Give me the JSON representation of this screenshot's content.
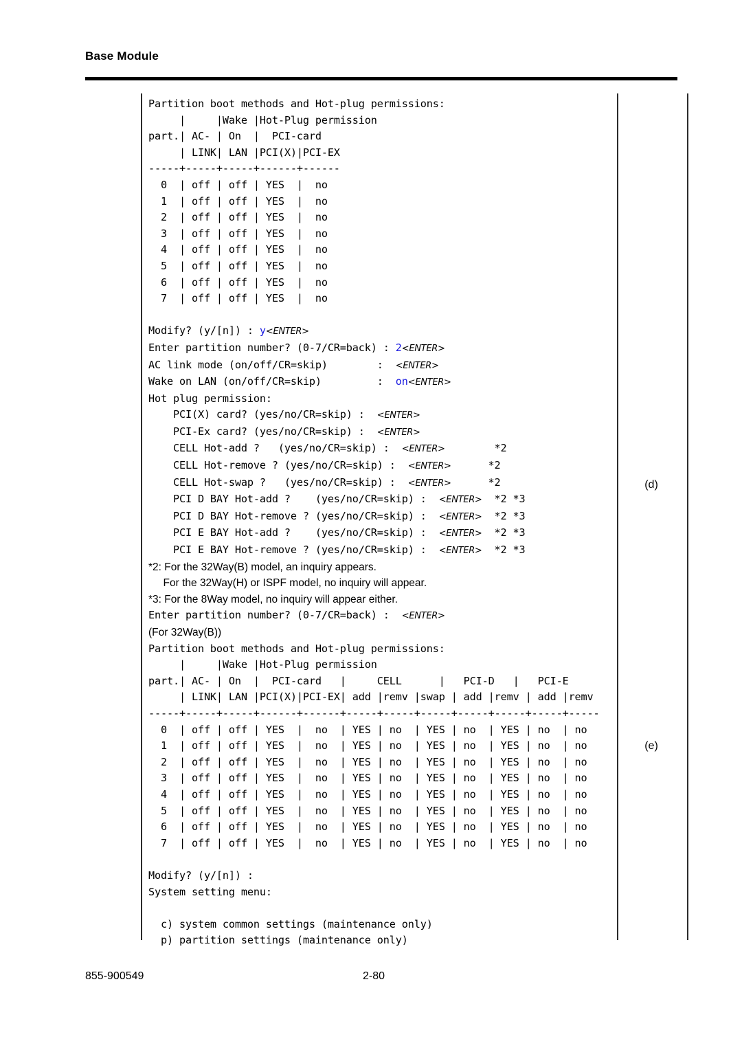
{
  "header": {
    "title": "Base Module"
  },
  "footer": {
    "doc_number": "855-900549",
    "page_number": "2-80"
  },
  "callouts": {
    "d": "(d)",
    "e": "(e)"
  },
  "terminal": {
    "lines": [
      {
        "text": "Partition boot methods and Hot-plug permissions:"
      },
      {
        "text": "     |     |Wake |Hot-Plug permission"
      },
      {
        "text": "part.| AC- | On  |  PCI-card"
      },
      {
        "text": "     | LINK| LAN |PCI(X)|PCI-EX"
      },
      {
        "text": "-----+-----+-----+------+------"
      },
      {
        "text": "  0  | off | off | YES  |  no"
      },
      {
        "text": "  1  | off | off | YES  |  no"
      },
      {
        "text": "  2  | off | off | YES  |  no"
      },
      {
        "text": "  3  | off | off | YES  |  no"
      },
      {
        "text": "  4  | off | off | YES  |  no"
      },
      {
        "text": "  5  | off | off | YES  |  no"
      },
      {
        "text": "  6  | off | off | YES  |  no"
      },
      {
        "text": "  7  | off | off | YES  |  no"
      },
      {
        "text": ""
      },
      {
        "segments": [
          {
            "text": "Modify? (y/[n]) : ",
            "style": "plain"
          },
          {
            "text": "y",
            "style": "input"
          },
          {
            "text": "<ENTER>",
            "style": "key"
          }
        ]
      },
      {
        "segments": [
          {
            "text": "Enter partition number? (0-7/CR=back) : ",
            "style": "plain"
          },
          {
            "text": "2",
            "style": "input"
          },
          {
            "text": "<ENTER>",
            "style": "key"
          }
        ]
      },
      {
        "segments": [
          {
            "text": "AC link mode (on/off/CR=skip)        :  ",
            "style": "plain"
          },
          {
            "text": "<ENTER>",
            "style": "key"
          }
        ]
      },
      {
        "segments": [
          {
            "text": "Wake on LAN (on/off/CR=skip)         :  ",
            "style": "plain"
          },
          {
            "text": "on",
            "style": "input"
          },
          {
            "text": "<ENTER>",
            "style": "key"
          }
        ]
      },
      {
        "text": "Hot plug permission:"
      },
      {
        "segments": [
          {
            "text": "    PCI(X) card? (yes/no/CR=skip) :  ",
            "style": "plain"
          },
          {
            "text": "<ENTER>",
            "style": "key"
          }
        ]
      },
      {
        "segments": [
          {
            "text": "    PCI-Ex card? (yes/no/CR=skip) :  ",
            "style": "plain"
          },
          {
            "text": "<ENTER>",
            "style": "key"
          }
        ]
      },
      {
        "segments": [
          {
            "text": "    CELL Hot-add ?   (yes/no/CR=skip) :  ",
            "style": "plain"
          },
          {
            "text": "<ENTER>",
            "style": "key"
          },
          {
            "text": "        *2",
            "style": "plain"
          }
        ]
      },
      {
        "segments": [
          {
            "text": "    CELL Hot-remove ? (yes/no/CR=skip) :  ",
            "style": "plain"
          },
          {
            "text": "<ENTER>",
            "style": "key"
          },
          {
            "text": "      *2",
            "style": "plain"
          }
        ]
      },
      {
        "segments": [
          {
            "text": "    CELL Hot-swap ?   (yes/no/CR=skip) :  ",
            "style": "plain"
          },
          {
            "text": "<ENTER>",
            "style": "key"
          },
          {
            "text": "      *2",
            "style": "plain"
          }
        ]
      },
      {
        "segments": [
          {
            "text": "    PCI D BAY Hot-add ?    (yes/no/CR=skip) :  ",
            "style": "plain"
          },
          {
            "text": "<ENTER>",
            "style": "key"
          },
          {
            "text": "  *2 *3",
            "style": "plain"
          }
        ]
      },
      {
        "segments": [
          {
            "text": "    PCI D BAY Hot-remove ? (yes/no/CR=skip) :  ",
            "style": "plain"
          },
          {
            "text": "<ENTER>",
            "style": "key"
          },
          {
            "text": "  *2 *3",
            "style": "plain"
          }
        ]
      },
      {
        "segments": [
          {
            "text": "    PCI E BAY Hot-add ?    (yes/no/CR=skip) :  ",
            "style": "plain"
          },
          {
            "text": "<ENTER>",
            "style": "key"
          },
          {
            "text": "  *2 *3",
            "style": "plain"
          }
        ]
      },
      {
        "segments": [
          {
            "text": "    PCI E BAY Hot-remove ? (yes/no/CR=skip) :  ",
            "style": "plain"
          },
          {
            "text": "<ENTER>",
            "style": "key"
          },
          {
            "text": "  *2 *3",
            "style": "plain"
          }
        ]
      },
      {
        "text": "*2: For the 32Way(B) model, an inquiry appears.",
        "style": "prose"
      },
      {
        "text": "     For the 32Way(H) or ISPF model, no inquiry will appear.",
        "style": "prose"
      },
      {
        "text": "*3: For the 8Way model, no inquiry will appear either.",
        "style": "prose"
      },
      {
        "segments": [
          {
            "text": "Enter partition number? (0-7/CR=back) :  ",
            "style": "plain"
          },
          {
            "text": "<ENTER>",
            "style": "key"
          }
        ]
      },
      {
        "text": "(For 32Way(B))",
        "style": "prose"
      },
      {
        "text": "Partition boot methods and Hot-plug permissions:"
      },
      {
        "text": "     |     |Wake |Hot-Plug permission"
      },
      {
        "text": "part.| AC- | On  |  PCI-card   |     CELL      |   PCI-D   |   PCI-E"
      },
      {
        "text": "     | LINK| LAN |PCI(X)|PCI-EX| add |remv |swap | add |remv | add |remv"
      },
      {
        "text": "-----+-----+-----+------+------+-----+-----+-----+-----+-----+-----+-----"
      },
      {
        "text": "  0  | off | off | YES  |  no  | YES | no  | YES | no  | YES | no  | no"
      },
      {
        "text": "  1  | off | off | YES  |  no  | YES | no  | YES | no  | YES | no  | no"
      },
      {
        "text": "  2  | off | off | YES  |  no  | YES | no  | YES | no  | YES | no  | no"
      },
      {
        "text": "  3  | off | off | YES  |  no  | YES | no  | YES | no  | YES | no  | no"
      },
      {
        "text": "  4  | off | off | YES  |  no  | YES | no  | YES | no  | YES | no  | no"
      },
      {
        "text": "  5  | off | off | YES  |  no  | YES | no  | YES | no  | YES | no  | no"
      },
      {
        "text": "  6  | off | off | YES  |  no  | YES | no  | YES | no  | YES | no  | no"
      },
      {
        "text": "  7  | off | off | YES  |  no  | YES | no  | YES | no  | YES | no  | no"
      },
      {
        "text": ""
      },
      {
        "text": "Modify? (y/[n]) :"
      },
      {
        "text": "System setting menu:"
      },
      {
        "text": ""
      },
      {
        "text": "  c) system common settings (maintenance only)"
      },
      {
        "text": "  p) partition settings (maintenance only)"
      }
    ]
  },
  "tables": {
    "first": {
      "caption": "Partition boot methods and Hot-plug permissions:",
      "columns": [
        "part.",
        "AC-LINK",
        "Wake On LAN",
        "PCI(X)",
        "PCI-EX"
      ],
      "rows": [
        [
          "0",
          "off",
          "off",
          "YES",
          "no"
        ],
        [
          "1",
          "off",
          "off",
          "YES",
          "no"
        ],
        [
          "2",
          "off",
          "off",
          "YES",
          "no"
        ],
        [
          "3",
          "off",
          "off",
          "YES",
          "no"
        ],
        [
          "4",
          "off",
          "off",
          "YES",
          "no"
        ],
        [
          "5",
          "off",
          "off",
          "YES",
          "no"
        ],
        [
          "6",
          "off",
          "off",
          "YES",
          "no"
        ],
        [
          "7",
          "off",
          "off",
          "YES",
          "no"
        ]
      ]
    },
    "second": {
      "caption": "Partition boot methods and Hot-plug permissions:",
      "columns": [
        "part.",
        "AC-LINK",
        "Wake On LAN",
        "PCI(X)",
        "PCI-EX",
        "CELL add",
        "CELL remv",
        "CELL swap",
        "PCI-D add",
        "PCI-D remv",
        "PCI-E add",
        "PCI-E remv"
      ],
      "rows": [
        [
          "0",
          "off",
          "off",
          "YES",
          "no",
          "YES",
          "no",
          "YES",
          "no",
          "YES",
          "no",
          "no"
        ],
        [
          "1",
          "off",
          "off",
          "YES",
          "no",
          "YES",
          "no",
          "YES",
          "no",
          "YES",
          "no",
          "no"
        ],
        [
          "2",
          "off",
          "off",
          "YES",
          "no",
          "YES",
          "no",
          "YES",
          "no",
          "YES",
          "no",
          "no"
        ],
        [
          "3",
          "off",
          "off",
          "YES",
          "no",
          "YES",
          "no",
          "YES",
          "no",
          "YES",
          "no",
          "no"
        ],
        [
          "4",
          "off",
          "off",
          "YES",
          "no",
          "YES",
          "no",
          "YES",
          "no",
          "YES",
          "no",
          "no"
        ],
        [
          "5",
          "off",
          "off",
          "YES",
          "no",
          "YES",
          "no",
          "YES",
          "no",
          "YES",
          "no",
          "no"
        ],
        [
          "6",
          "off",
          "off",
          "YES",
          "no",
          "YES",
          "no",
          "YES",
          "no",
          "YES",
          "no",
          "no"
        ],
        [
          "7",
          "off",
          "off",
          "YES",
          "no",
          "YES",
          "no",
          "YES",
          "no",
          "YES",
          "no",
          "no"
        ]
      ]
    }
  },
  "colors": {
    "user_input": "#1a1ae0",
    "text": "#000000",
    "rule": "#2b2b2b"
  }
}
